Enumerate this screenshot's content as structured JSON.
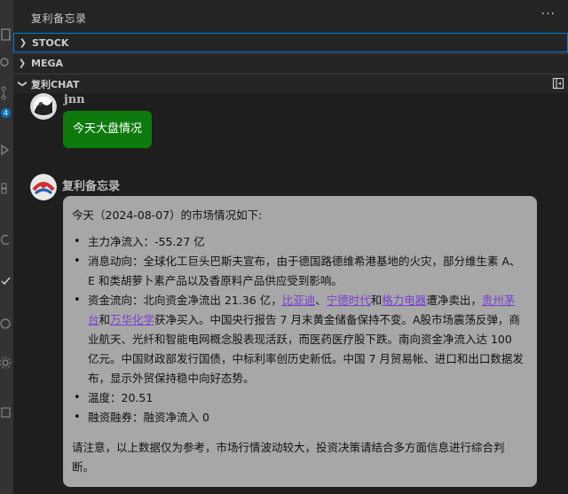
{
  "sidebar": {
    "title": "复利备忘录",
    "more": "···"
  },
  "activity": {
    "badge": "4"
  },
  "sections": {
    "stock": "STOCK",
    "mega": "MEGA",
    "chat": "复利CHAT"
  },
  "chat": {
    "user": {
      "name": "jnn",
      "message": "今天大盘情况"
    },
    "bot": {
      "name": "复利备忘录",
      "intro": "今天（2024-08-07）的市场情况如下:",
      "items": [
        {
          "text": "主力净流入：-55.27 亿"
        },
        {
          "text": "消息动向：全球化工巨头巴斯夫宣布，由于德国路德维希港基地的火灾，部分维生素 A、E 和类胡萝卜素产品以及香原料产品供应受到影响。"
        }
      ],
      "capital_flow": {
        "prefix": "资金流向：北向资金净流出 21.36 亿，",
        "link1": "比亚迪",
        "sep1": "、",
        "link2": "宁德时代",
        "sep2": "和",
        "link3": "格力电器",
        "mid": "遭净卖出，",
        "link4": "贵州茅台",
        "sep3": "和",
        "link5": "万华化学",
        "suffix": "获净买入。中国央行报告 7 月末黄金储备保持不变。A股市场震荡反弹，商业航天、光纤和智能电网概念股表现活跃，而医药医疗股下跌。南向资金净流入达 100 亿元。中国财政部发行国债，中标利率创历史新低。中国 7 月贸易帐、进口和出口数据发布，显示外贸保持稳中向好态势。"
      },
      "temperature": "温度：20.51",
      "margin": "融资融券：融资净流入 0",
      "note": "请注意，以上数据仅为参考，市场行情波动较大，投资决策请结合多方面信息进行综合判断。"
    }
  },
  "colors": {
    "user_bubble": "#0e7a0d",
    "bot_bubble": "#a7a7a7",
    "link": "#7b3fd1",
    "focus_border": "#007fd4"
  }
}
